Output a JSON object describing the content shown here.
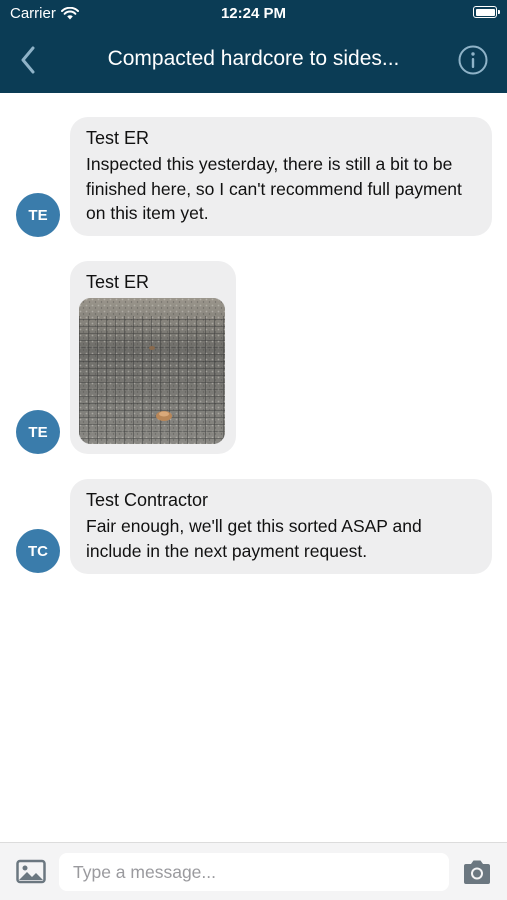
{
  "colors": {
    "header_bg": "#0b3c55",
    "avatar_bg": "#3a7cab",
    "bubble_bg": "#eeeeef",
    "icon_gray": "#6b7780"
  },
  "status_bar": {
    "carrier": "Carrier",
    "time": "12:24 PM",
    "icons": [
      "wifi-icon",
      "battery-icon"
    ]
  },
  "nav": {
    "title": "Compacted hardcore to sides...",
    "back_icon": "chevron-left-icon",
    "info_icon": "info-icon"
  },
  "messages": [
    {
      "avatar": "TE",
      "sender": "Test ER",
      "text": "Inspected this yesterday, there is still a bit to be finished here, so I can't recommend full payment on this item yet."
    },
    {
      "avatar": "TE",
      "sender": "Test ER",
      "image": "photo-of-compacted-hardcore-mesh"
    },
    {
      "avatar": "TC",
      "sender": "Test Contractor",
      "text": "Fair enough, we'll get this sorted ASAP and include in the next payment request."
    }
  ],
  "composer": {
    "placeholder": "Type a message...",
    "value": "",
    "gallery_icon": "image-icon",
    "camera_icon": "camera-icon"
  }
}
